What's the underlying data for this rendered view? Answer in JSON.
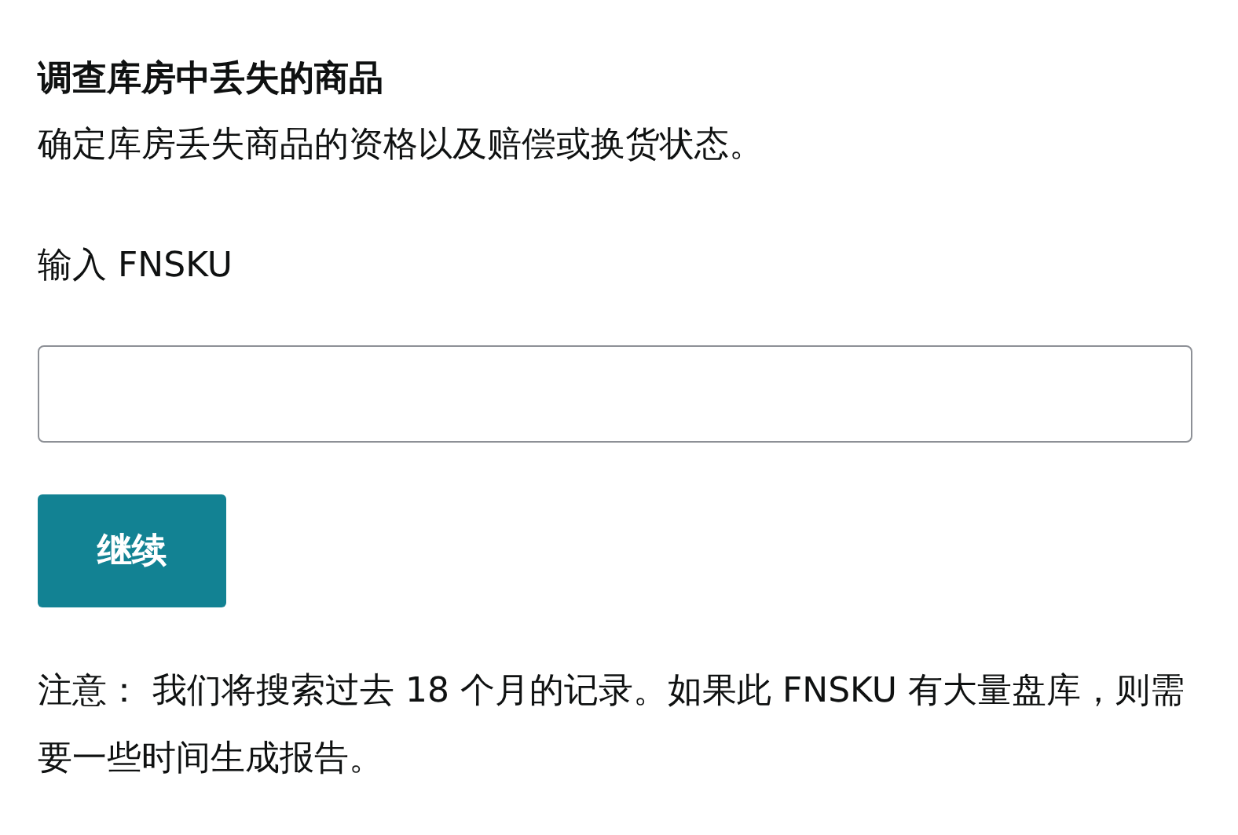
{
  "heading": "调查库房中丢失的商品",
  "description": "确定库房丢失商品的资格以及赔偿或换货状态。",
  "fnsku_field": {
    "label": "输入 FNSKU"
  },
  "continue_button": "继续",
  "note": "注意：  我们将搜索过去 18 个月的记录。如果此 FNSKU 有大量盘库，则需要一些时间生成报告。"
}
